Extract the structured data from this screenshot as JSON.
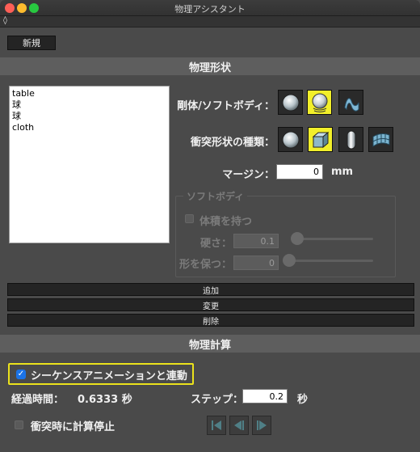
{
  "window": {
    "title": "物理アシスタント"
  },
  "panel_handle_icon": "◊",
  "toolbar": {
    "new_label": "新規"
  },
  "physics_shape": {
    "header": "物理形状",
    "list_items": [
      "table",
      "球",
      "球",
      "cloth"
    ],
    "rigid_soft_label": "剛体/ソフトボディ：",
    "rigid_soft_options": [
      "rigid-sphere-icon",
      "soft-sphere-icon",
      "cloth-icon"
    ],
    "rigid_soft_selected": 1,
    "collision_label": "衝突形状の種類：",
    "collision_options": [
      "sphere-icon",
      "box-icon",
      "capsule-icon",
      "mesh-icon"
    ],
    "collision_selected": 1,
    "margin_label": "マージン：",
    "margin_value": "0",
    "margin_unit": "mm",
    "softbody": {
      "group_title": "ソフトボディ",
      "keep_volume_label": "体積を持つ",
      "stiffness_label": "硬さ：",
      "stiffness_value": "0.1",
      "shape_keep_label": "形を保つ：",
      "shape_keep_value": "0"
    },
    "add_label": "追加",
    "modify_label": "変更",
    "delete_label": "削除"
  },
  "physics_calc": {
    "header": "物理計算",
    "sequence_link_label": "シーケンスアニメーションと連動",
    "sequence_link_checked": true,
    "elapsed_label": "経過時間：",
    "elapsed_value": "0.6333 秒",
    "step_label": "ステップ：",
    "step_value": "0.2",
    "step_unit": "秒",
    "stop_on_collision_label": "衝突時に計算停止"
  },
  "colors": {
    "accent_yellow": "#f2ef2a",
    "checkbox_blue": "#1a73e8"
  }
}
